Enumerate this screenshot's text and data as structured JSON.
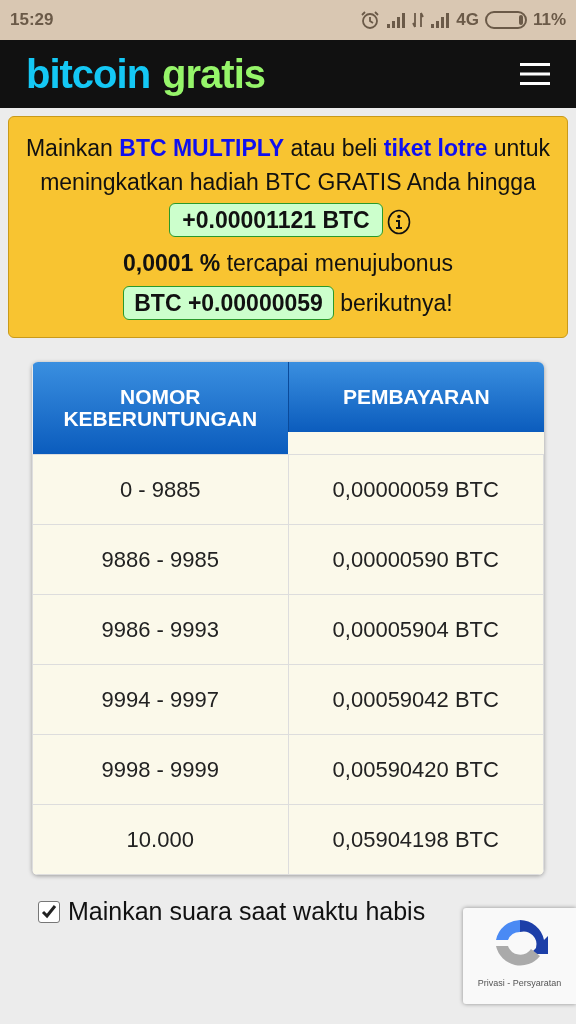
{
  "status_bar": {
    "time": "15:29",
    "network": "4G",
    "battery": "11%"
  },
  "header": {
    "logo_first": "bitcoin",
    "logo_second": "gratis"
  },
  "promo": {
    "text": "Mainkan **BTC MULTIPLY** atau beli **tiket lotre** untuk meningkatkan hadiah BTC GRATIS Anda hingga",
    "amount": "+0.00001121 BTC",
    "progress": "0,0001 %",
    "progress_text": "tercapai menujubonus",
    "bonus": "BTC +0.00000059",
    "bonus_suffix": "berikutnya!"
  },
  "table": {
    "columns": [
      "NOMOR KEBERUNTUNGAN",
      "PEMBAYARAN"
    ],
    "rows": [
      {
        "range": "0 - 9885",
        "payout": "0,00000059 BTC"
      },
      {
        "range": "9886 - 9985",
        "payout": "0,00000590 BTC"
      },
      {
        "range": "9986 - 9993",
        "payout": "0,00005904 BTC"
      },
      {
        "range": "9994 - 9997",
        "payout": "0,00059042 BTC"
      },
      {
        "range": "9998 - 9999",
        "payout": "0,00590420 BTC"
      },
      {
        "range": "10.000",
        "payout": "0,05904198 BTC"
      }
    ]
  },
  "sound_option": {
    "label": "Mainkan suara saat waktu habis",
    "checked": true
  },
  "recaptcha": {
    "text": "Privasi - Persyaratan"
  }
}
